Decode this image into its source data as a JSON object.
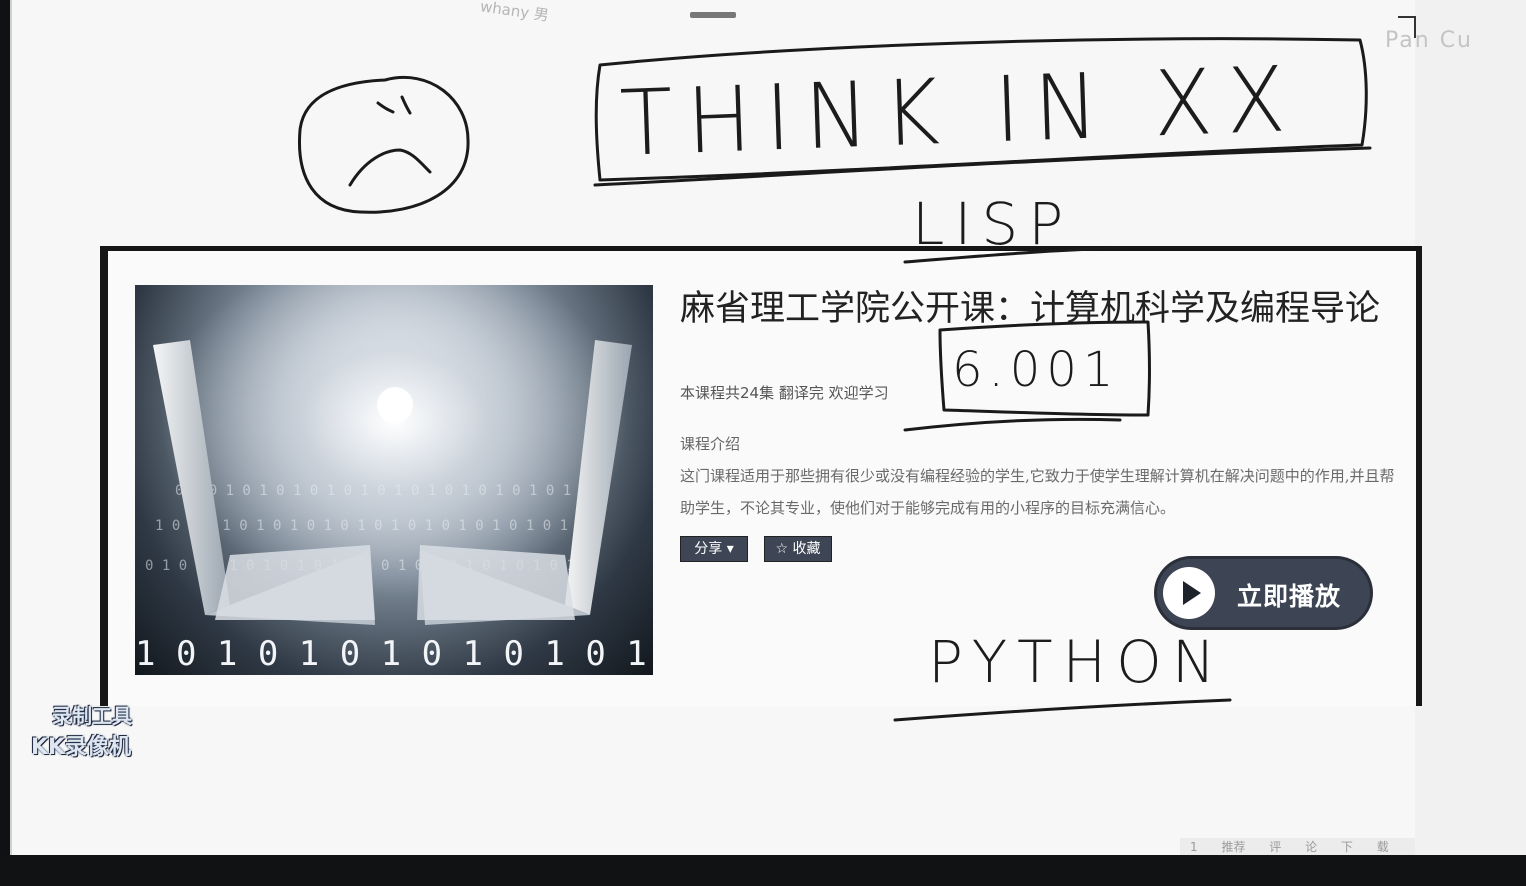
{
  "screen": {
    "username_tag": "whany 男",
    "blurred_header_text": "Pan Cu"
  },
  "annotations": {
    "think_in": "THINK IN XX",
    "lisp": "LISP",
    "course_number": "6.001",
    "python": "PYTHON"
  },
  "course": {
    "title": "麻省理工学院公开课：计算机科学及编程导论",
    "meta": "本课程共24集 翻译完 欢迎学习",
    "intro_label": "课程介绍",
    "intro_text": "这门课程适用于那些拥有很少或没有编程经验的学生,它致力于使学生理解计算机在解决问题中的作用,并且帮助学生，不论其专业，使他们对于能够完成有用的小程序的目标充满信心。",
    "share_label": "分享 ▾",
    "favorite_label": "☆ 收藏",
    "play_label": "立即播放"
  },
  "watermark": {
    "line1": "录制工具",
    "line2": "KK录像机"
  },
  "bottom_tabs": "1 推荐 评 论 下 载"
}
